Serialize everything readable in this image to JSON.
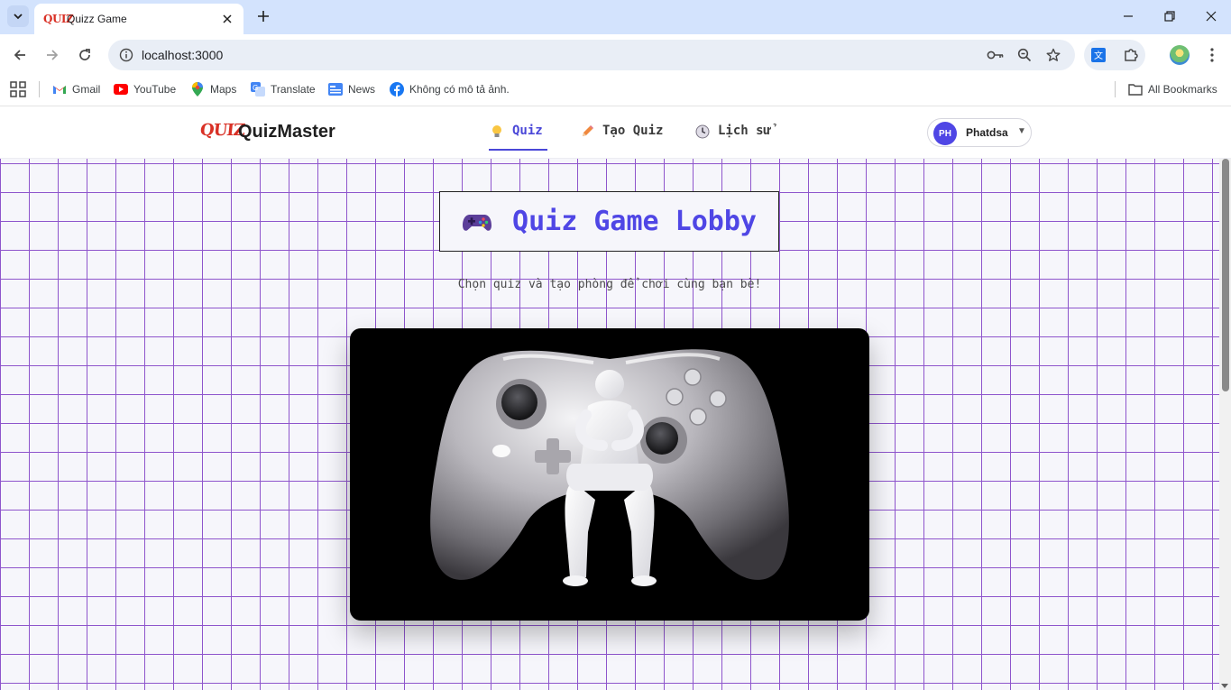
{
  "browser": {
    "tab_title": "Quizz Game",
    "tab_favicon_text": "QUIZ",
    "url": "localhost:3000",
    "bookmarks": [
      {
        "label": "Gmail",
        "icon": "gmail-icon"
      },
      {
        "label": "YouTube",
        "icon": "youtube-icon"
      },
      {
        "label": "Maps",
        "icon": "maps-icon"
      },
      {
        "label": "Translate",
        "icon": "translate-icon"
      },
      {
        "label": "News",
        "icon": "news-icon"
      },
      {
        "label": "Không có mô tả ảnh.",
        "icon": "facebook-icon"
      }
    ],
    "all_bookmarks": "All Bookmarks"
  },
  "app": {
    "logo_text": "QUIZ",
    "brand": "QuizMaster",
    "nav": [
      {
        "label": "Quiz",
        "icon": "lightbulb-icon",
        "active": true
      },
      {
        "label": "Tạo Quiz",
        "icon": "pencil-icon",
        "active": false
      },
      {
        "label": "Lịch sử",
        "icon": "clock-icon",
        "active": false
      }
    ],
    "user": {
      "initials": "PH",
      "name": "Phatdsa",
      "caret": "▼"
    }
  },
  "lobby": {
    "title": "Quiz Game Lobby",
    "title_icon": "gamepad-icon",
    "subtitle": "Chọn quiz và tạo phòng để chơi cùng bạn bè!",
    "hero_image": "game-controller-figure-image"
  },
  "colors": {
    "accent": "#4f46e5",
    "grid_line": "#8e55cc",
    "tabstrip": "#d3e3fd"
  }
}
